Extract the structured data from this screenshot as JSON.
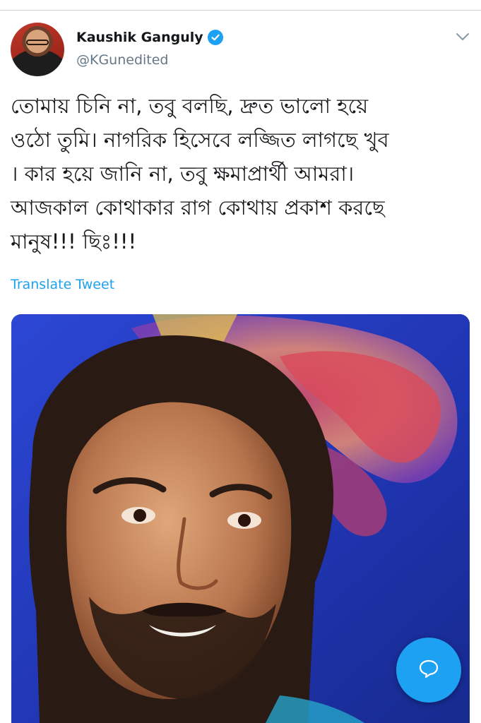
{
  "author": {
    "name": "Kaushik Ganguly",
    "handle": "@KGunedited",
    "verified": true
  },
  "tweet": {
    "lines": [
      "তোমায় চিনি না, তবু বলছি, দ্রুত ভালো হয়ে",
      "ওঠো তুমি। নাগরিক হিসেবে লজ্জিত লাগছে খুব",
      "। কার হয়ে জানি না, তবু ক্ষমাপ্রার্থী আমরা।",
      "আজকাল কোথাকার রাগ কোথায় প্রকাশ করছে",
      "মানুষ!!! ছিঃ!!!"
    ],
    "translate_label": "Translate Tweet"
  },
  "icons": {
    "menu": "chevron-down-icon",
    "verified": "verified-badge-icon",
    "compose": "reply-bubble-icon"
  },
  "colors": {
    "accent": "#1da1f2",
    "secondary_text": "#657786"
  }
}
